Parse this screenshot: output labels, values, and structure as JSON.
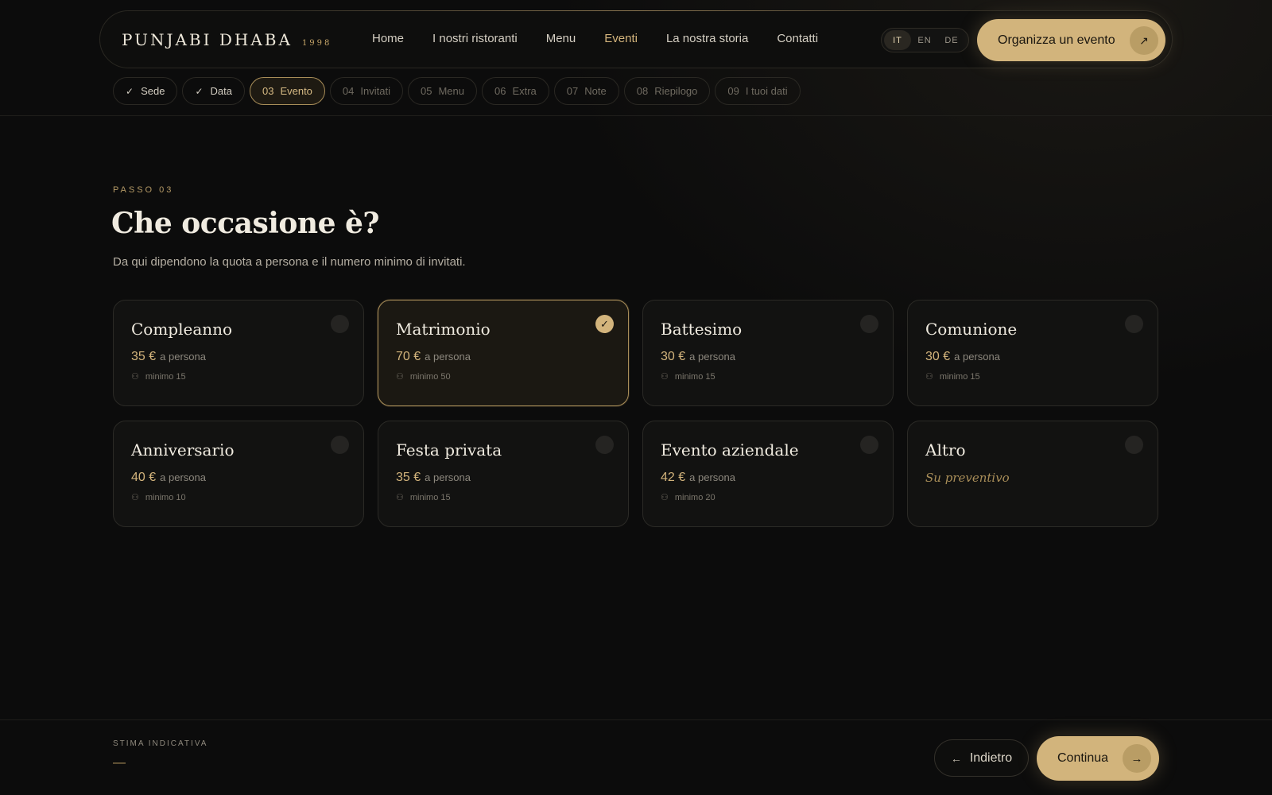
{
  "header": {
    "logo_text": "PUNJABI DHABA",
    "logo_year": "1998",
    "nav": [
      "Home",
      "I nostri ristoranti",
      "Menu",
      "Eventi",
      "La nostra storia",
      "Contatti"
    ],
    "active_nav": "Eventi",
    "languages": [
      "IT",
      "EN",
      "DE"
    ],
    "active_language": "IT",
    "cta_label": "Organizza un evento",
    "cta_icon": "arrow-up-right-icon"
  },
  "steps": [
    {
      "num": "",
      "label": "Sede",
      "state": "done"
    },
    {
      "num": "",
      "label": "Data",
      "state": "done"
    },
    {
      "num": "03",
      "label": "Evento",
      "state": "current"
    },
    {
      "num": "04",
      "label": "Invitati",
      "state": "upcoming"
    },
    {
      "num": "05",
      "label": "Menu",
      "state": "upcoming"
    },
    {
      "num": "06",
      "label": "Extra",
      "state": "upcoming"
    },
    {
      "num": "07",
      "label": "Note",
      "state": "upcoming"
    },
    {
      "num": "08",
      "label": "Riepilogo",
      "state": "upcoming"
    },
    {
      "num": "09",
      "label": "I tuoi dati",
      "state": "upcoming"
    }
  ],
  "main": {
    "eyebrow": "PASSO 03",
    "title": "Che occasione è?",
    "subtitle": "Da qui dipendono la quota a persona e il numero minimo di invitati."
  },
  "occasions": [
    {
      "name": "Compleanno",
      "price": "35 €",
      "unit": "a persona",
      "min": "minimo 15",
      "selected": false
    },
    {
      "name": "Matrimonio",
      "price": "70 €",
      "unit": "a persona",
      "min": "minimo 50",
      "selected": true
    },
    {
      "name": "Battesimo",
      "price": "30 €",
      "unit": "a persona",
      "min": "minimo 15",
      "selected": false
    },
    {
      "name": "Comunione",
      "price": "30 €",
      "unit": "a persona",
      "min": "minimo 15",
      "selected": false
    },
    {
      "name": "Anniversario",
      "price": "40 €",
      "unit": "a persona",
      "min": "minimo 10",
      "selected": false
    },
    {
      "name": "Festa privata",
      "price": "35 €",
      "unit": "a persona",
      "min": "minimo 15",
      "selected": false
    },
    {
      "name": "Evento aziendale",
      "price": "42 €",
      "unit": "a persona",
      "min": "minimo 20",
      "selected": false
    },
    {
      "name": "Altro",
      "quote": "Su preventivo",
      "selected": false
    }
  ],
  "footer": {
    "estimate_label": "STIMA INDICATIVA",
    "estimate_value": "—",
    "back_label": "Indietro",
    "next_label": "Continua"
  },
  "colors": {
    "accent": "#d2b47c",
    "background": "#0c0c0c",
    "card": "#121211"
  }
}
